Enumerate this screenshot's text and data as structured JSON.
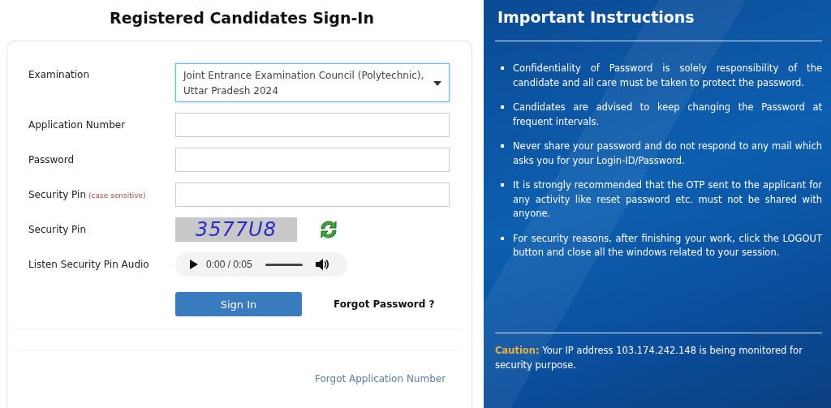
{
  "title": "Registered Candidates Sign-In",
  "form": {
    "fields": [
      {
        "kind": "select",
        "label": "Examination",
        "value": "Joint Entrance Examination Council (Polytechnic), Uttar Pradesh 2024"
      },
      {
        "kind": "text",
        "label": "Application Number"
      },
      {
        "kind": "text",
        "label": "Password"
      },
      {
        "kind": "text",
        "label": "Security Pin",
        "hint": "(case sensitive)"
      },
      {
        "kind": "captcha",
        "label": "Security Pin",
        "captcha": "3577U8"
      },
      {
        "kind": "audio",
        "label": "Listen Security Pin Audio",
        "time": "0:00 / 0:05"
      }
    ],
    "sign_in_button": "Sign In",
    "forgot_password": "Forgot Password ?",
    "forgot_application_number": "Forgot Application Number"
  },
  "instructions": {
    "title": "Important Instructions",
    "items": [
      "Confidentiality of Password is solely responsibility of the candidate and all care must be taken to protect the password.",
      "Candidates are advised to keep changing the Password at frequent intervals.",
      "Never share your password and do not respond to any mail which asks you for your Login-ID/Password.",
      "It is strongly recommended that the OTP sent to the applicant for any activity like reset password etc. must not be shared with anyone.",
      "For security reasons, after finishing your work, click the LOGOUT button and close all the windows related to your session."
    ],
    "caution_label": "Caution:",
    "caution_text": "Your IP address 103.174.242.148 is being monitored for security purpose."
  }
}
